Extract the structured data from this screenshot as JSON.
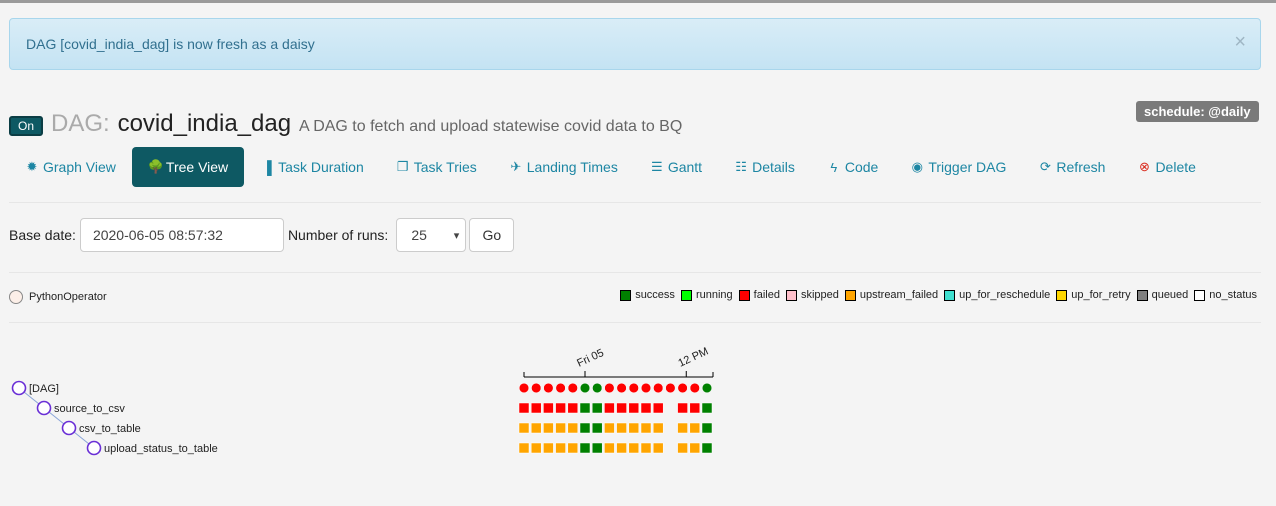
{
  "alert": {
    "message": "DAG [covid_india_dag] is now fresh as a daisy",
    "close": "×"
  },
  "dag": {
    "toggle_label": "On",
    "prefix": "DAG:",
    "id": "covid_india_dag",
    "description": "A DAG to fetch and upload statewise covid data to BQ",
    "schedule": "schedule: @daily"
  },
  "nav": [
    {
      "label": "Graph View",
      "icon": "sun-icon",
      "glyph": "✹"
    },
    {
      "label": "Tree View",
      "icon": "tree-icon",
      "glyph": "🌳",
      "active": true
    },
    {
      "label": "Task Duration",
      "icon": "bar-chart-icon",
      "glyph": "▐"
    },
    {
      "label": "Task Tries",
      "icon": "copy-icon",
      "glyph": "❐"
    },
    {
      "label": "Landing Times",
      "icon": "plane-icon",
      "glyph": "✈"
    },
    {
      "label": "Gantt",
      "icon": "align-left-icon",
      "glyph": "☰"
    },
    {
      "label": "Details",
      "icon": "list-icon",
      "glyph": "☷"
    },
    {
      "label": "Code",
      "icon": "flash-icon",
      "glyph": "ϟ"
    },
    {
      "label": "Trigger DAG",
      "icon": "play-circle-icon",
      "glyph": "◉"
    },
    {
      "label": "Refresh",
      "icon": "refresh-icon",
      "glyph": "⟳"
    },
    {
      "label": "Delete",
      "icon": "remove-circle-icon",
      "glyph": "⊗"
    }
  ],
  "form": {
    "base_date_label": "Base date:",
    "base_date_value": "2020-06-05 08:57:32",
    "runs_label": "Number of runs:",
    "runs_value": "25",
    "runs_caret": "▾",
    "go_label": "Go"
  },
  "operator_legend": {
    "label": "PythonOperator",
    "color": "#fcefe8"
  },
  "status_legend": [
    {
      "label": "success",
      "color": "#008000"
    },
    {
      "label": "running",
      "color": "#00ff00"
    },
    {
      "label": "failed",
      "color": "#ff0000"
    },
    {
      "label": "skipped",
      "color": "#ffc0cb"
    },
    {
      "label": "upstream_failed",
      "color": "#ffa500"
    },
    {
      "label": "up_for_reschedule",
      "color": "#40e0d0"
    },
    {
      "label": "up_for_retry",
      "color": "#ffd700"
    },
    {
      "label": "queued",
      "color": "#808080"
    },
    {
      "label": "no_status",
      "color": "#ffffff"
    }
  ],
  "tree": {
    "nodes": [
      "[DAG]",
      "source_to_csv",
      "csv_to_table",
      "upload_status_to_table"
    ],
    "axis_labels": [
      "Fri 05",
      "12 PM"
    ],
    "colors": {
      "S": "#008000",
      "F": "#ff0000",
      "U": "#ffa500"
    },
    "runs": [
      "F",
      "F",
      "F",
      "F",
      "F",
      "S",
      "S",
      "F",
      "F",
      "F",
      "F",
      "F",
      "F",
      "F",
      "F",
      "S"
    ],
    "missing_run_index": 11,
    "task_states": [
      [
        "F",
        "F",
        "F",
        "F",
        "F",
        "S",
        "S",
        "F",
        "F",
        "F",
        "F",
        "F",
        "-",
        "F",
        "F",
        "S"
      ],
      [
        "U",
        "U",
        "U",
        "U",
        "U",
        "S",
        "S",
        "U",
        "U",
        "U",
        "U",
        "U",
        "-",
        "U",
        "U",
        "S"
      ],
      [
        "U",
        "U",
        "U",
        "U",
        "U",
        "S",
        "S",
        "U",
        "U",
        "U",
        "U",
        "U",
        "-",
        "U",
        "U",
        "S"
      ]
    ]
  }
}
